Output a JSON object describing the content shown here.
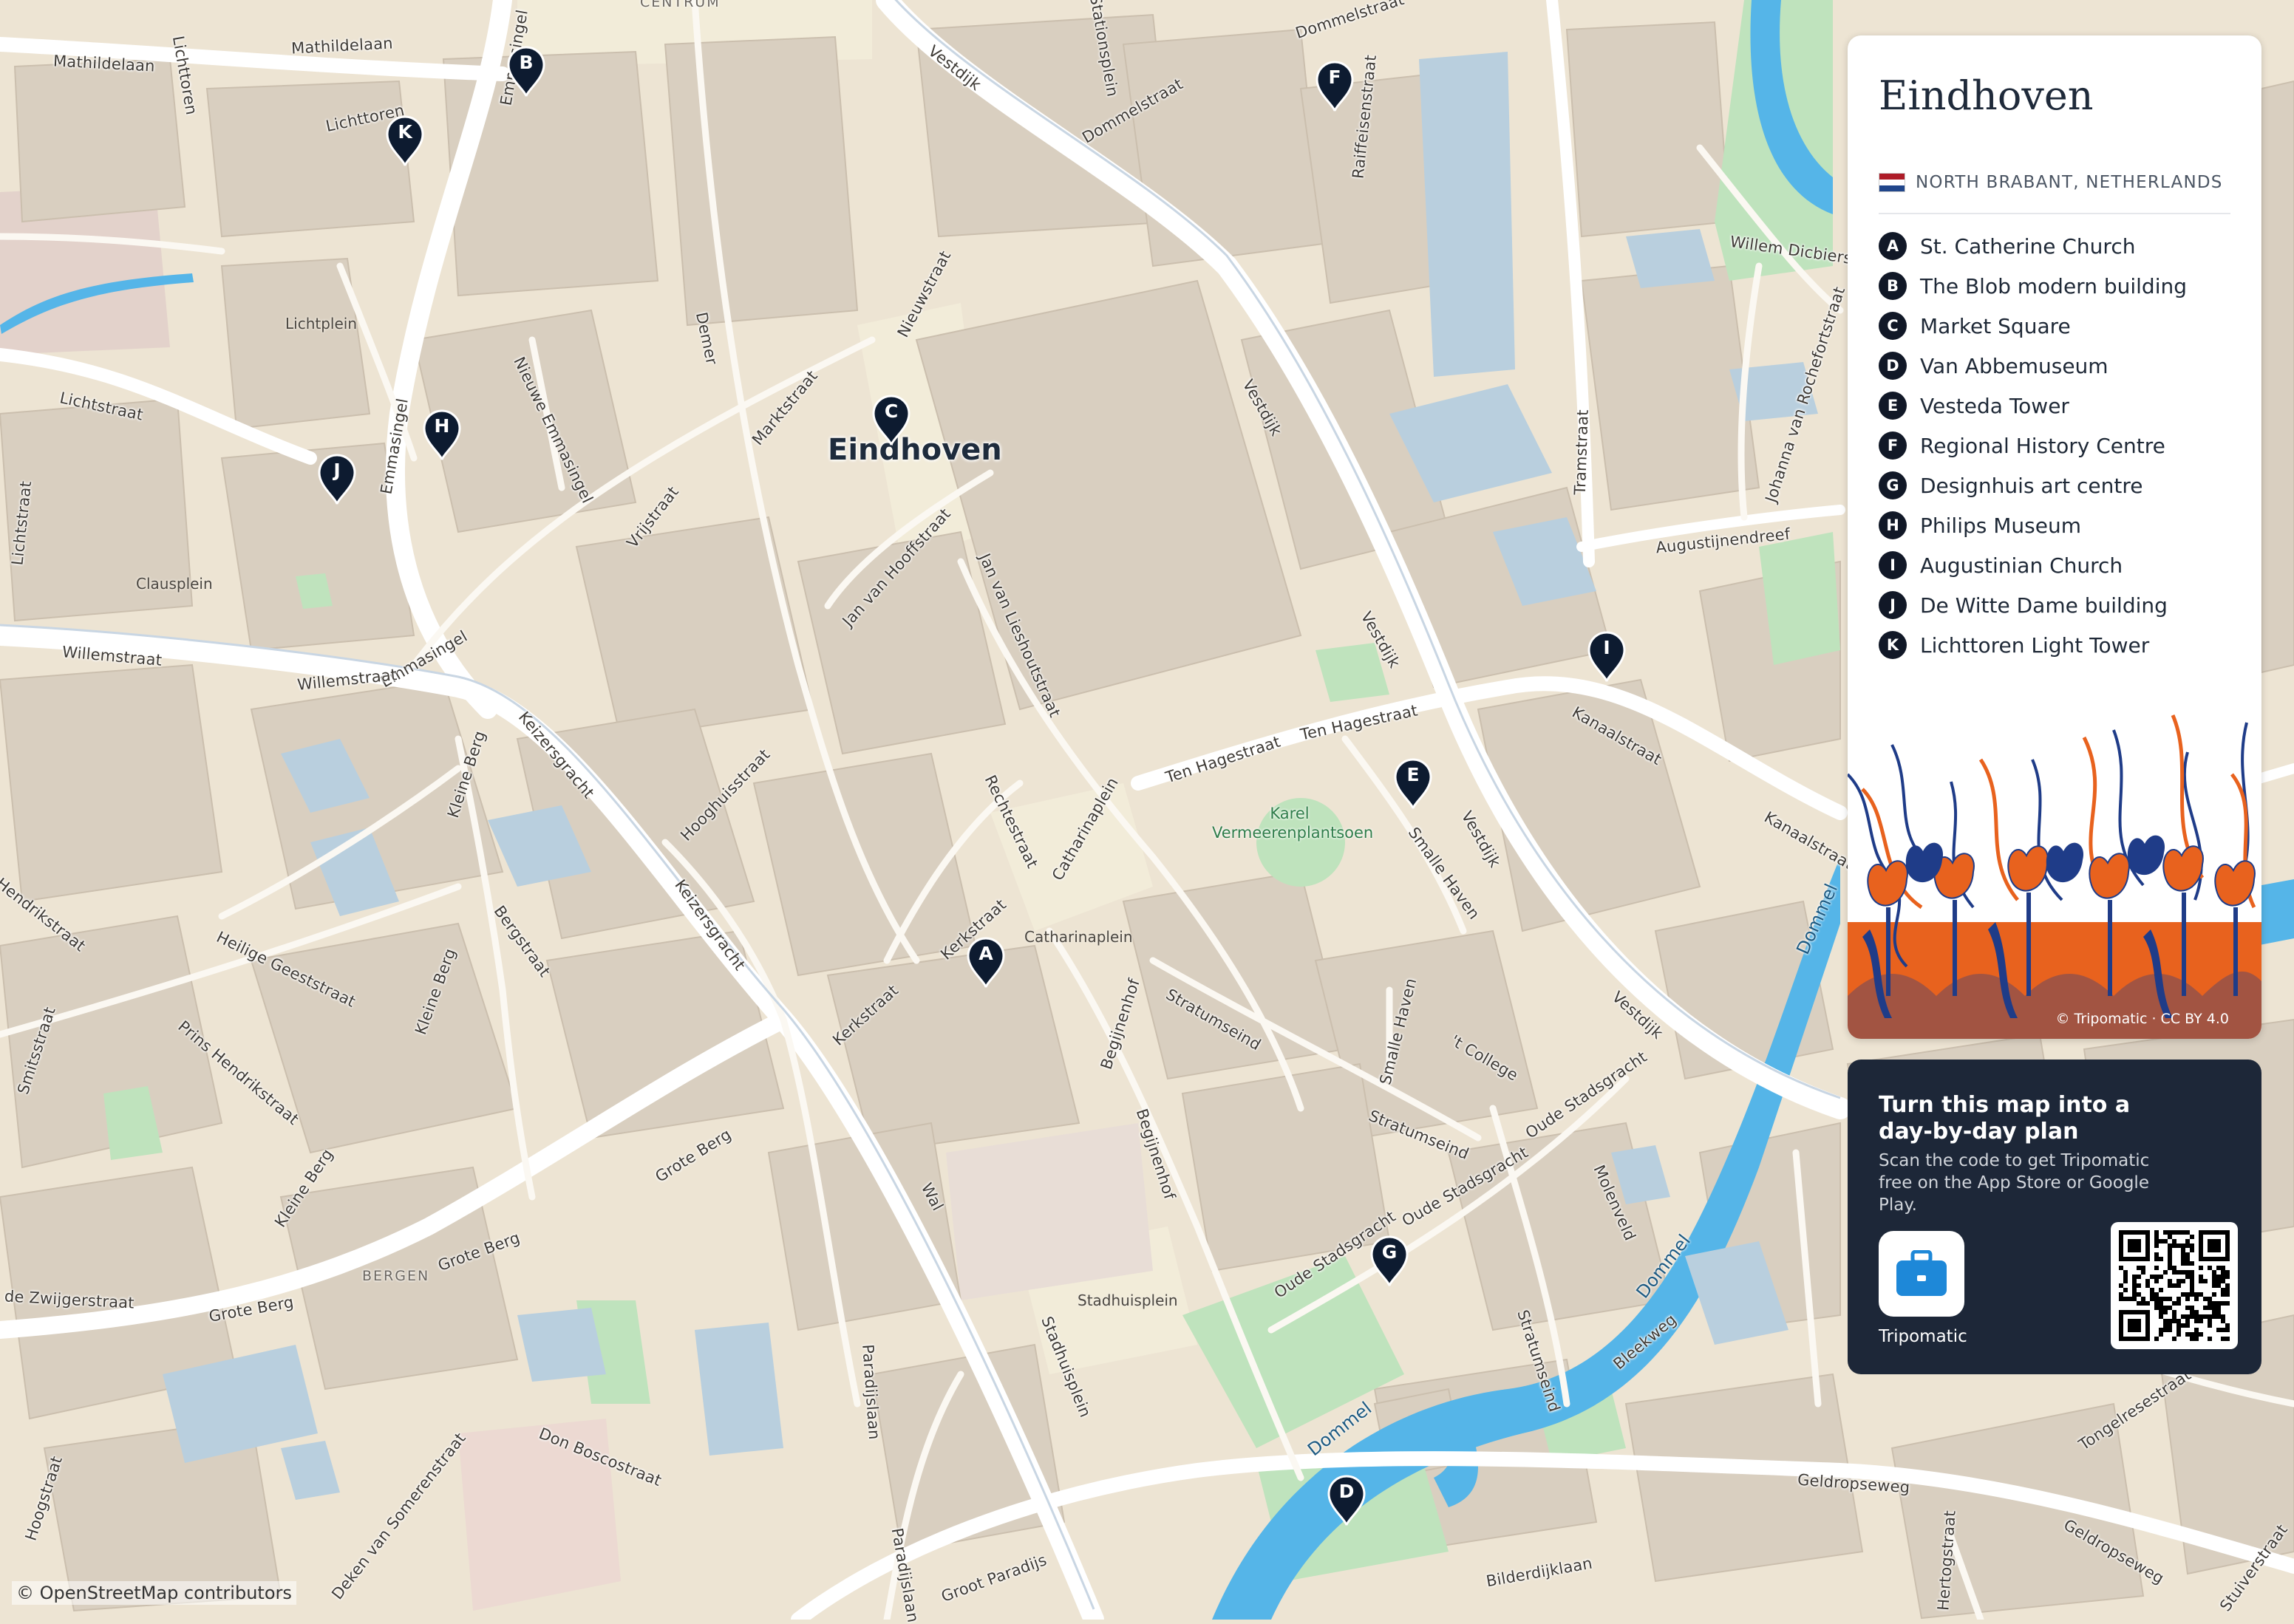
{
  "map": {
    "city_name": "Eindhoven",
    "attribution": "© OpenStreetMap contributors",
    "districts": [
      "CENTRUM",
      "BERGEN"
    ],
    "places": [
      "Lichtplein",
      "Clausplein",
      "Catharinaplein",
      "Stadhuisplein"
    ],
    "park": "Karel Vermeerenplantsoen",
    "waterway": "Dommel",
    "streets": [
      "Mathildelaan",
      "Lichttoren",
      "Emmasingel",
      "Stationsplein",
      "Dommelstraat",
      "Vestdijk",
      "Raiffeisenstraat",
      "Willem Dicbierstraat",
      "Lichtstraat",
      "Nieuwe Emmasingel",
      "Demer",
      "Nieuwstraat",
      "Marktstraat",
      "Vrijstraat",
      "Jan van Hooffstraat",
      "Jan van Lieshoutstraat",
      "Willemstraat",
      "Keizersgracht",
      "Hooghuisstraat",
      "Rechtestraat",
      "Ten Hagestraat",
      "Catharinaplein",
      "Kerkstraat",
      "Begijnenhof",
      "Stratumseind",
      "Smalle Haven",
      "Kanaalstraat",
      "Kleine Berg",
      "Bergstraat",
      "Heilige Geeststraat",
      "Hendrikstraat",
      "Prins Hendrikstraat",
      "Smitsstraat",
      "Grote Berg",
      "Wal",
      "Stadhuisplein",
      "Paradijslaan",
      "Don Boscostraat",
      "Deken van Somerenstraat",
      "Groot Paradijs",
      "Oude Stadsgracht",
      "Molenveld",
      "Bleekweg",
      "Geldropseweg",
      "Bilderdijklaan",
      "Hertogstraat",
      "Stuiverstraat",
      "Tongelresestraat",
      "Augustijnendreef",
      "Johanna van Rochefortstraat",
      "Tramstraat",
      "'t College",
      "Hoogstraat",
      "Jan de Zwijgerstraat"
    ],
    "markers": [
      {
        "letter": "A",
        "name": "St. Catherine Church"
      },
      {
        "letter": "B",
        "name": "The Blob modern building"
      },
      {
        "letter": "C",
        "name": "Market Square"
      },
      {
        "letter": "D",
        "name": "Van Abbemuseum"
      },
      {
        "letter": "E",
        "name": "Vesteda Tower"
      },
      {
        "letter": "F",
        "name": "Regional History Centre"
      },
      {
        "letter": "G",
        "name": "Designhuis art centre"
      },
      {
        "letter": "H",
        "name": "Philips Museum"
      },
      {
        "letter": "I",
        "name": "Augustinian Church"
      },
      {
        "letter": "J",
        "name": "De Witte Dame building"
      },
      {
        "letter": "K",
        "name": "Lichttoren Light Tower"
      }
    ]
  },
  "panel": {
    "title": "Eindhoven",
    "region": "NORTH BRABANT, NETHERLANDS",
    "credit": "© Tripomatic · CC BY 4.0",
    "flag_colors": [
      "#ae1c28",
      "#ffffff",
      "#21468b"
    ]
  },
  "promo": {
    "title": "Turn this map into a day-by-day plan",
    "body": "Scan the code to get Tripomatic free on the App Store or Google Play.",
    "app_name": "Tripomatic"
  },
  "colors": {
    "land": "#ede4d3",
    "building": "#d9cfc0",
    "water": "#55b5e8",
    "park": "#bfe3bd",
    "road": "#ffffff",
    "marker": "#0d1b30",
    "tulip_orange": "#e8621e",
    "tulip_blue": "#1f3c88",
    "promo_bg": "#1d2738"
  },
  "icons": {
    "marker": "map-pin-icon",
    "app": "briefcase-icon",
    "qr": "qr-code-icon",
    "flag": "netherlands-flag-icon"
  }
}
